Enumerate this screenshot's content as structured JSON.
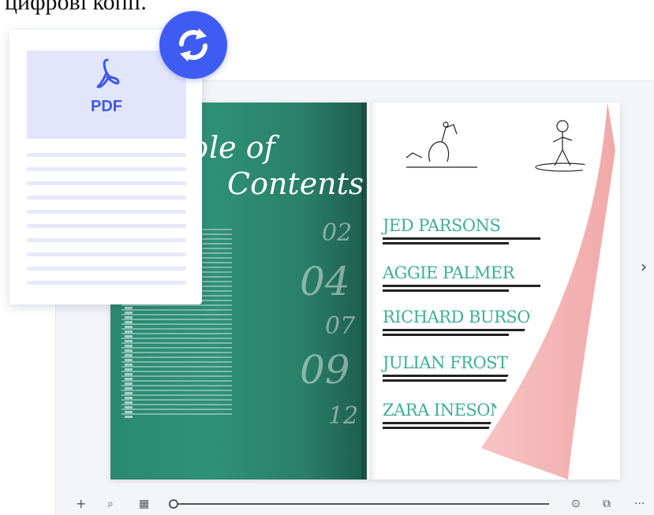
{
  "caption": "цифрові копії.",
  "book": {
    "toc_line1": "able of",
    "toc_line2": "Contents",
    "numbers": [
      "02",
      "04",
      "07",
      "09",
      "12"
    ],
    "entries": [
      {
        "name": "JED PARSONS"
      },
      {
        "name": "AGGIE PALMER"
      },
      {
        "name": "RICHARD BURSON"
      },
      {
        "name": "JULIAN FROST"
      },
      {
        "name": "ZARA INESON"
      }
    ]
  },
  "pdf_card": {
    "label": "PDF",
    "icon": "acrobat-icon"
  },
  "sync_button": {
    "icon": "sync-icon"
  },
  "next_arrow": "›",
  "toolbar": {
    "zoom_in": "+",
    "search": "⌕",
    "thumbnails": "▦",
    "audio": "⊙",
    "share": "⧉",
    "more": "···"
  },
  "colors": {
    "accent": "#3f5cf2",
    "pdf_bg": "#e3e6fb",
    "page_green": "#2a8a70",
    "flap_pink": "#f5b8b8"
  }
}
